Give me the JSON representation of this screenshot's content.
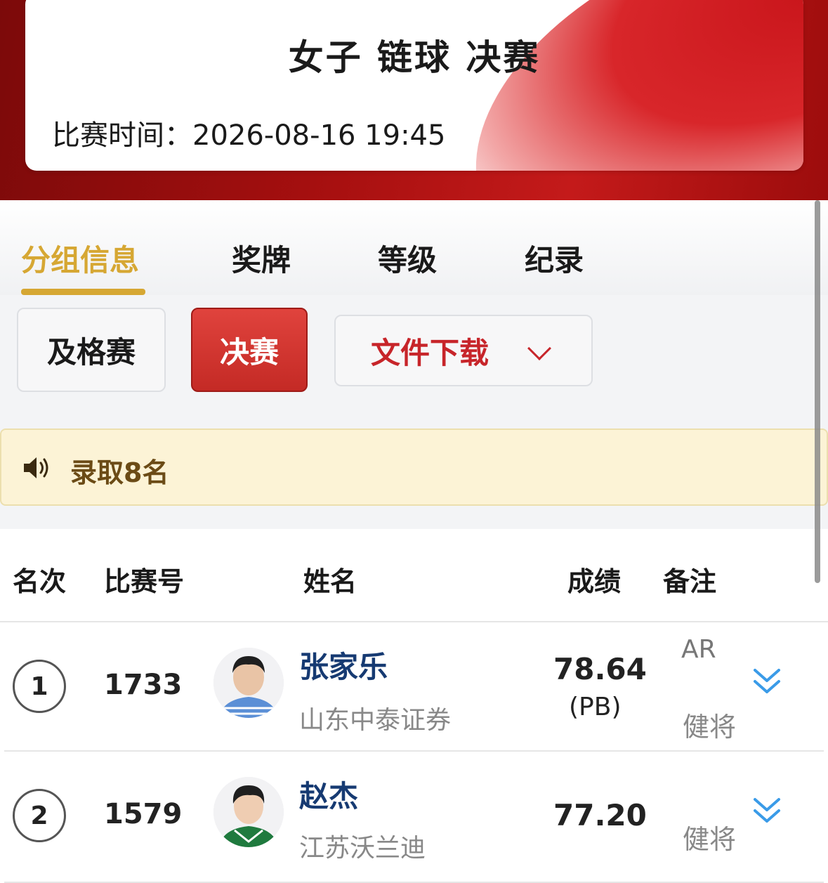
{
  "header": {
    "event_title": "女子 链球 决赛",
    "time_label": "比赛时间：",
    "time_value": "2026-08-16  19:45"
  },
  "tabs": [
    {
      "label": "分组信息",
      "active": true
    },
    {
      "label": "奖牌",
      "active": false
    },
    {
      "label": "等级",
      "active": false
    },
    {
      "label": "纪录",
      "active": false
    }
  ],
  "rounds": {
    "qualifying": "及格赛",
    "final": "决赛",
    "selected": "决赛",
    "download_label": "文件下载"
  },
  "notice": {
    "text": "录取8名",
    "icon": "speaker-icon"
  },
  "table": {
    "headers": {
      "rank": "名次",
      "bib": "比赛号",
      "name": "姓名",
      "mark": "成绩",
      "note": "备注"
    },
    "rows": [
      {
        "rank": "1",
        "bib": "1733",
        "name": "张家乐",
        "team": "山东中泰证券",
        "mark": "78.64",
        "pb": "(PB)",
        "record": "AR",
        "note": "健将"
      },
      {
        "rank": "2",
        "bib": "1579",
        "name": "赵杰",
        "team": "江苏沃兰迪",
        "mark": "77.20",
        "pb": "",
        "record": "",
        "note": "健将"
      }
    ]
  },
  "colors": {
    "brand_red": "#c7252a",
    "active_tab_gold": "#d6a733",
    "athlete_name_blue": "#163a72",
    "notice_bg": "#fcf3d6",
    "expand_icon_blue": "#3a9be8"
  }
}
